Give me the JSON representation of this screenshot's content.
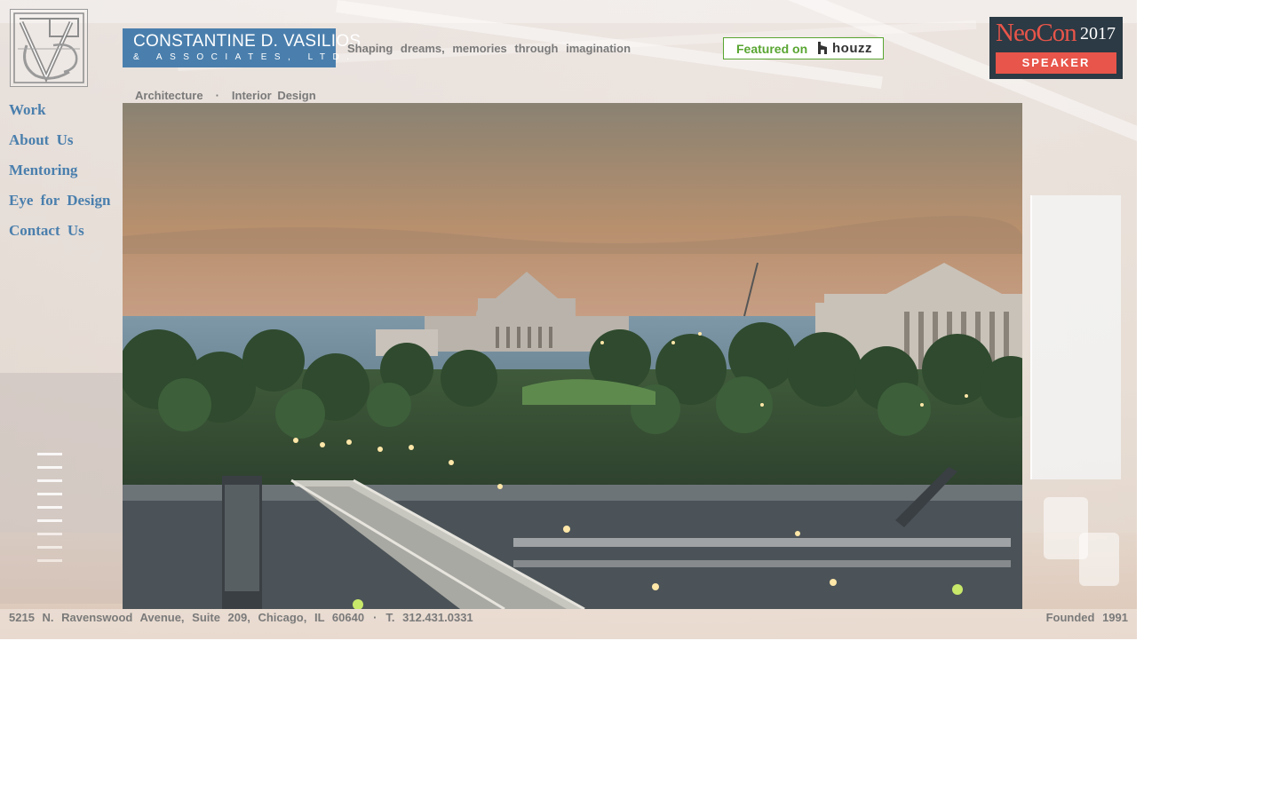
{
  "brand": {
    "name": "CONSTANTINE D. VASILIOS",
    "subtitle": "& ASSOCIATES, LTD.",
    "logo_icon": "cdv-monogram-logo",
    "brand_color": "#4a7fad"
  },
  "tagline": "Shaping dreams, memories through imagination",
  "houzz": {
    "featured_text": "Featured on",
    "houzz_text": "houzz",
    "icon": "houzz-h-icon",
    "color": "#58a531"
  },
  "neocon": {
    "name": "NeoCon",
    "year": "2017",
    "role": "SPEAKER",
    "accent": "#e8554a",
    "background": "#2b3a44"
  },
  "services": {
    "architecture": "Architecture",
    "separator": "·",
    "interior": "Interior Design"
  },
  "nav": {
    "items": [
      {
        "label": "Work"
      },
      {
        "label": "About Us"
      },
      {
        "label": "Mentoring"
      },
      {
        "label": "Eye for Design"
      },
      {
        "label": "Contact Us"
      }
    ]
  },
  "hero": {
    "image_icon": "chicago-museum-campus-photo"
  },
  "footer": {
    "address": "5215 N. Ravenswood Avenue, Suite 209, Chicago, IL 60640",
    "separator": "·",
    "phone": "T. 312.431.0331",
    "founded": "Founded 1991"
  }
}
